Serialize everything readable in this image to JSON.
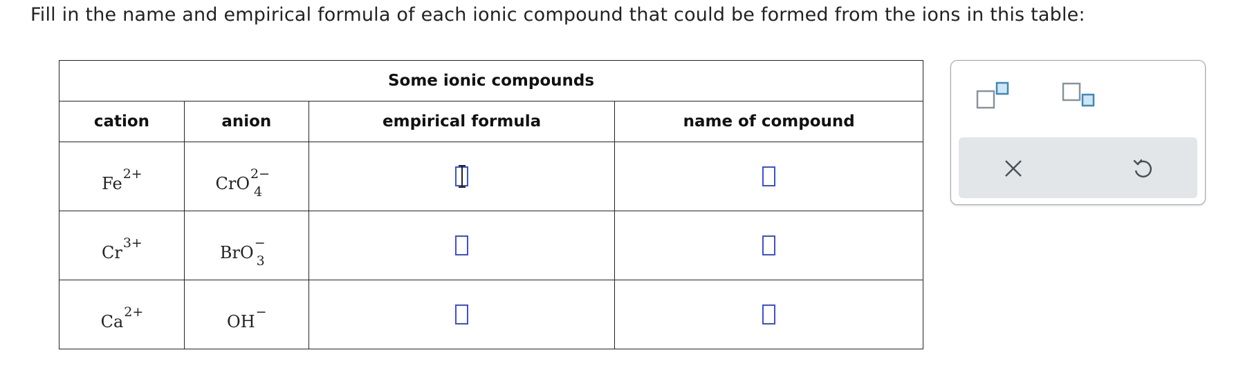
{
  "prompt": "Fill in the name and empirical formula of each ionic compound that could be formed from the ions in this table:",
  "table": {
    "caption": "Some ionic compounds",
    "headers": {
      "cation": "cation",
      "anion": "anion",
      "formula": "empirical formula",
      "name": "name of compound"
    },
    "rows": [
      {
        "cation": {
          "symbol": "Fe",
          "charge": "2+"
        },
        "anion": {
          "symbol": "CrO",
          "sub": "4",
          "charge": "2−"
        }
      },
      {
        "cation": {
          "symbol": "Cr",
          "charge": "3+"
        },
        "anion": {
          "symbol": "BrO",
          "sub": "3",
          "charge": "−"
        }
      },
      {
        "cation": {
          "symbol": "Ca",
          "charge": "2+"
        },
        "anion": {
          "symbol": "OH",
          "sub": "",
          "charge": "−"
        }
      }
    ]
  },
  "palette": {
    "tools": [
      "superscript-icon",
      "subscript-icon",
      "clear-icon",
      "undo-icon"
    ],
    "accent_color": "#6aaed6",
    "blank_color": "#3b4fd6"
  }
}
